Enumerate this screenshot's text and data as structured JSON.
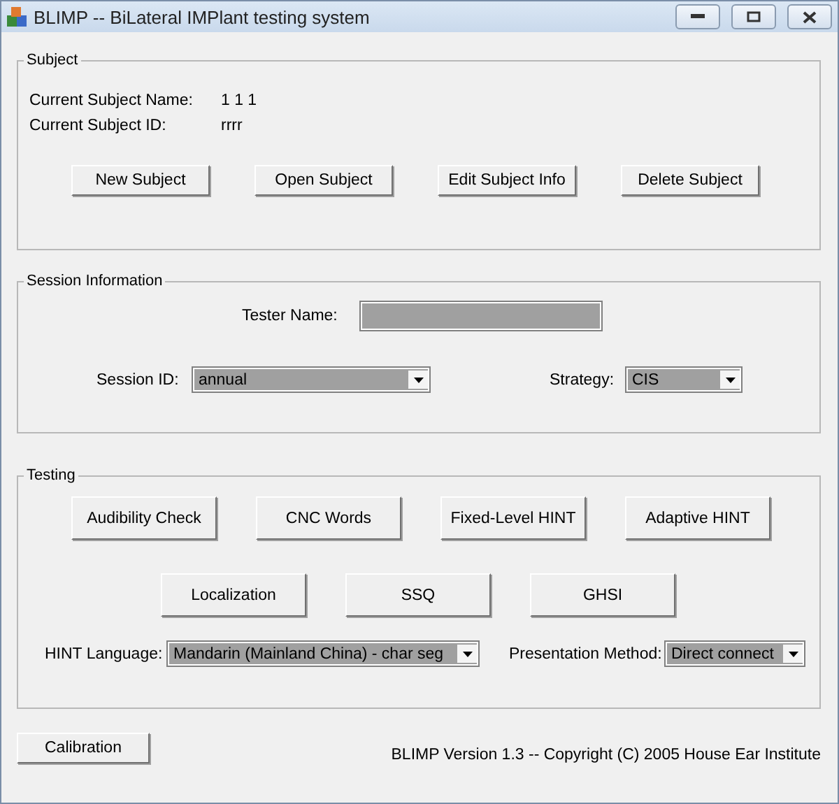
{
  "window": {
    "title": "BLIMP -- BiLateral IMPlant testing system"
  },
  "subject": {
    "title": "Subject",
    "fields": [
      {
        "label": "Current Subject Name:",
        "value": "1 1 1"
      },
      {
        "label": "Current Subject ID:",
        "value": "rrrr"
      }
    ],
    "buttons": [
      "New Subject",
      "Open Subject",
      "Edit Subject Info",
      "Delete Subject"
    ]
  },
  "session": {
    "title": "Session Information",
    "tester_label": "Tester Name:",
    "session_label": "Session ID:",
    "session_value": "annual",
    "strategy_label": "Strategy:",
    "strategy_value": "CIS"
  },
  "testing": {
    "title": "Testing",
    "buttons_row_1": [
      "Audibility Check",
      "CNC Words",
      "Fixed-Level HINT",
      "Adaptive HINT"
    ],
    "buttons_row_2": [
      "Localization",
      "SSQ",
      "GHSI"
    ],
    "language_label": "HINT Language:",
    "language_value": "Mandarin (Mainland China) - char seg",
    "method_label": "Presentation Method:",
    "method_value": "Direct connect"
  },
  "footer": {
    "button": "Calibration",
    "copyright": "BLIMP Version 1.3 -- Copyright (C) 2005 House Ear Institute"
  }
}
